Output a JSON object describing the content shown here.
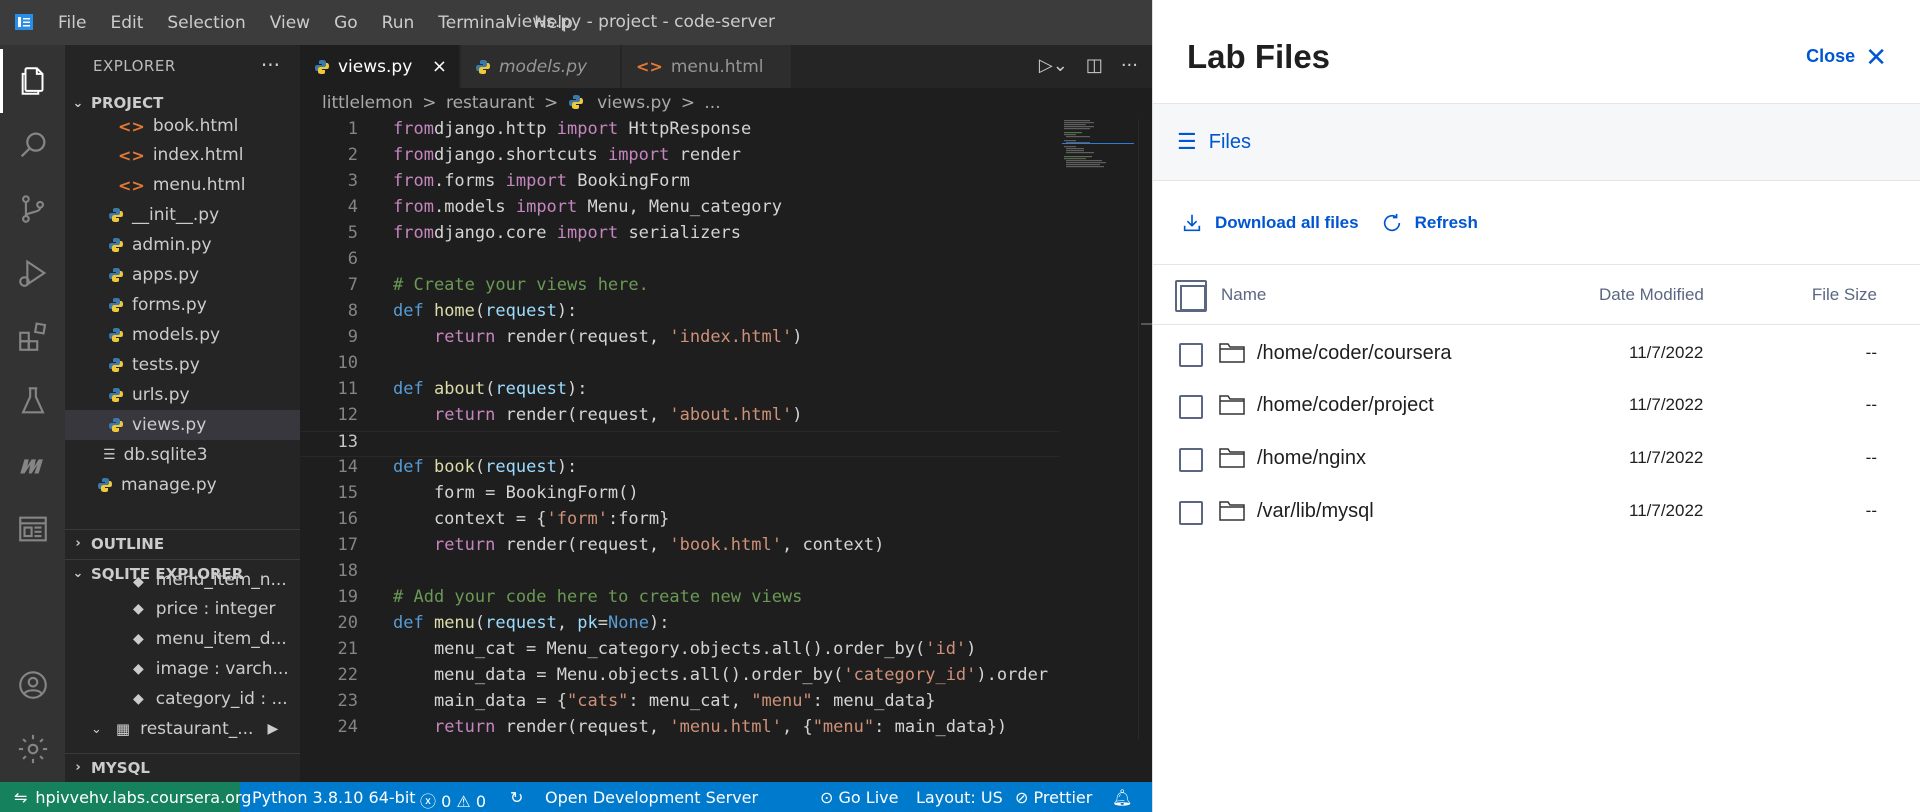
{
  "titlebar": {
    "menu": [
      "File",
      "Edit",
      "Selection",
      "View",
      "Go",
      "Run",
      "Terminal",
      "Help"
    ],
    "window_title": "views.py - project - code-server"
  },
  "activitybar": {
    "icons": [
      "explorer-icon",
      "search-icon",
      "source-control-icon",
      "run-debug-icon",
      "extensions-icon",
      "testing-icon",
      "mm-icon",
      "browser-preview-icon",
      "account-icon",
      "settings-gear-icon"
    ]
  },
  "sidebar": {
    "title": "EXPLORER",
    "more": "···",
    "project_header": "PROJECT",
    "files": [
      {
        "name": "book.html",
        "type": "html"
      },
      {
        "name": "index.html",
        "type": "html"
      },
      {
        "name": "menu.html",
        "type": "html"
      },
      {
        "name": "__init__.py",
        "type": "py"
      },
      {
        "name": "admin.py",
        "type": "py"
      },
      {
        "name": "apps.py",
        "type": "py"
      },
      {
        "name": "forms.py",
        "type": "py"
      },
      {
        "name": "models.py",
        "type": "py"
      },
      {
        "name": "tests.py",
        "type": "py"
      },
      {
        "name": "urls.py",
        "type": "py"
      },
      {
        "name": "views.py",
        "type": "py"
      },
      {
        "name": "db.sqlite3",
        "type": "db"
      },
      {
        "name": "manage.py",
        "type": "py"
      }
    ],
    "outline_header": "OUTLINE",
    "sqlite_header": "SQLITE EXPLORER",
    "sqlite_items": [
      "menu_item_n...",
      "price : integer",
      "menu_item_d...",
      "image : varch...",
      "category_id : ..."
    ],
    "sqlite_table": "restaurant_...",
    "mysql_header": "MYSQL"
  },
  "tabs": [
    {
      "label": "views.py",
      "active": true,
      "close": "×"
    },
    {
      "label": "models.py",
      "active": false
    },
    {
      "label": "menu.html",
      "active": false
    }
  ],
  "breadcrumb": {
    "parts": [
      "littlelemon",
      "restaurant",
      "views.py",
      "..."
    ],
    "sep": ">"
  },
  "code": {
    "lines": [
      {
        "n": "1",
        "t": [
          [
            "kw",
            "from"
          ],
          [
            "",
            "django.http "
          ],
          [
            "kw",
            "import"
          ],
          [
            "",
            " HttpResponse"
          ]
        ]
      },
      {
        "n": "2",
        "t": [
          [
            "kw",
            "from"
          ],
          [
            "",
            "django.shortcuts "
          ],
          [
            "kw",
            "import"
          ],
          [
            "",
            " render"
          ]
        ]
      },
      {
        "n": "3",
        "t": [
          [
            "kw",
            "from"
          ],
          [
            "",
            ".forms "
          ],
          [
            "kw",
            "import"
          ],
          [
            "",
            " BookingForm"
          ]
        ]
      },
      {
        "n": "4",
        "t": [
          [
            "kw",
            "from"
          ],
          [
            "",
            ".models "
          ],
          [
            "kw",
            "import"
          ],
          [
            "",
            " Menu, Menu_category"
          ]
        ]
      },
      {
        "n": "5",
        "t": [
          [
            "kw",
            "from"
          ],
          [
            "",
            "django.core "
          ],
          [
            "kw",
            "import"
          ],
          [
            "",
            " serializers"
          ]
        ]
      },
      {
        "n": "6",
        "t": []
      },
      {
        "n": "7",
        "t": [
          [
            "cm",
            "# Create your views here."
          ]
        ]
      },
      {
        "n": "8",
        "t": [
          [
            "bi",
            "def "
          ],
          [
            "fn",
            "home"
          ],
          [
            "",
            "("
          ],
          [
            "var",
            "request"
          ],
          [
            "",
            "):"
          ]
        ]
      },
      {
        "n": "9",
        "t": [
          [
            "",
            "    "
          ],
          [
            "kw",
            "return"
          ],
          [
            "",
            " render(request, "
          ],
          [
            "str",
            "'index.html'"
          ],
          [
            "",
            ")"
          ]
        ]
      },
      {
        "n": "10",
        "t": []
      },
      {
        "n": "11",
        "t": [
          [
            "bi",
            "def "
          ],
          [
            "fn",
            "about"
          ],
          [
            "",
            "("
          ],
          [
            "var",
            "request"
          ],
          [
            "",
            "):"
          ]
        ]
      },
      {
        "n": "12",
        "t": [
          [
            "",
            "    "
          ],
          [
            "kw",
            "return"
          ],
          [
            "",
            " render(request, "
          ],
          [
            "str",
            "'about.html'"
          ],
          [
            "",
            ")"
          ]
        ]
      },
      {
        "n": "13",
        "t": [],
        "current": true
      },
      {
        "n": "14",
        "t": [
          [
            "bi",
            "def "
          ],
          [
            "fn",
            "book"
          ],
          [
            "",
            "("
          ],
          [
            "var",
            "request"
          ],
          [
            "",
            "):"
          ]
        ]
      },
      {
        "n": "15",
        "t": [
          [
            "",
            "    form = BookingForm()"
          ]
        ]
      },
      {
        "n": "16",
        "t": [
          [
            "",
            "    context = {"
          ],
          [
            "str",
            "'form'"
          ],
          [
            "",
            ":form}"
          ]
        ]
      },
      {
        "n": "17",
        "t": [
          [
            "",
            "    "
          ],
          [
            "kw",
            "return"
          ],
          [
            "",
            " render(request, "
          ],
          [
            "str",
            "'book.html'"
          ],
          [
            "",
            ", context)"
          ]
        ]
      },
      {
        "n": "18",
        "t": []
      },
      {
        "n": "19",
        "t": [
          [
            "cm",
            "# Add your code here to create new views"
          ]
        ]
      },
      {
        "n": "20",
        "t": [
          [
            "bi",
            "def "
          ],
          [
            "fn",
            "menu"
          ],
          [
            "",
            "("
          ],
          [
            "var",
            "request"
          ],
          [
            "",
            ", "
          ],
          [
            "var",
            "pk"
          ],
          [
            "",
            "="
          ],
          [
            "bi",
            "None"
          ],
          [
            "",
            "):"
          ]
        ]
      },
      {
        "n": "21",
        "t": [
          [
            "",
            "    menu_cat = Menu_category.objects.all().order_by("
          ],
          [
            "str",
            "'id'"
          ],
          [
            "",
            ")"
          ]
        ]
      },
      {
        "n": "22",
        "t": [
          [
            "",
            "    menu_data = Menu.objects.all().order_by("
          ],
          [
            "str",
            "'category_id'"
          ],
          [
            "",
            ").order"
          ]
        ]
      },
      {
        "n": "23",
        "t": [
          [
            "",
            "    main_data = {"
          ],
          [
            "str",
            "\"cats\""
          ],
          [
            "",
            ": menu_cat, "
          ],
          [
            "str",
            "\"menu\""
          ],
          [
            "",
            ": menu_data}"
          ]
        ]
      },
      {
        "n": "24",
        "t": [
          [
            "",
            "    "
          ],
          [
            "kw",
            "return"
          ],
          [
            "",
            " render(request, "
          ],
          [
            "str",
            "'menu.html'"
          ],
          [
            "",
            ", {"
          ],
          [
            "str",
            "\"menu\""
          ],
          [
            "",
            ": main_data})"
          ]
        ]
      }
    ]
  },
  "statusbar": {
    "remote": "hpivvehv.labs.coursera.org",
    "python": "Python 3.8.10 64-bit",
    "errors": "0",
    "warnings": "0",
    "sync": "↻",
    "open_server": "Open Development Server",
    "golive": "Go Live",
    "layout": "Layout: US",
    "prettier": "Prettier"
  },
  "lab": {
    "title": "Lab Files",
    "close": "Close",
    "files_label": "Files",
    "download_all": "Download all files",
    "refresh": "Refresh",
    "columns": {
      "name": "Name",
      "date": "Date Modified",
      "size": "File Size"
    },
    "rows": [
      {
        "name": "/home/coder/coursera",
        "date": "11/7/2022",
        "size": "--"
      },
      {
        "name": "/home/coder/project",
        "date": "11/7/2022",
        "size": "--"
      },
      {
        "name": "/home/nginx",
        "date": "11/7/2022",
        "size": "--"
      },
      {
        "name": "/var/lib/mysql",
        "date": "11/7/2022",
        "size": "--"
      }
    ]
  },
  "colors": {
    "accent": "#007acc",
    "remote_green": "#16825d",
    "lab_blue": "#0056d2"
  }
}
